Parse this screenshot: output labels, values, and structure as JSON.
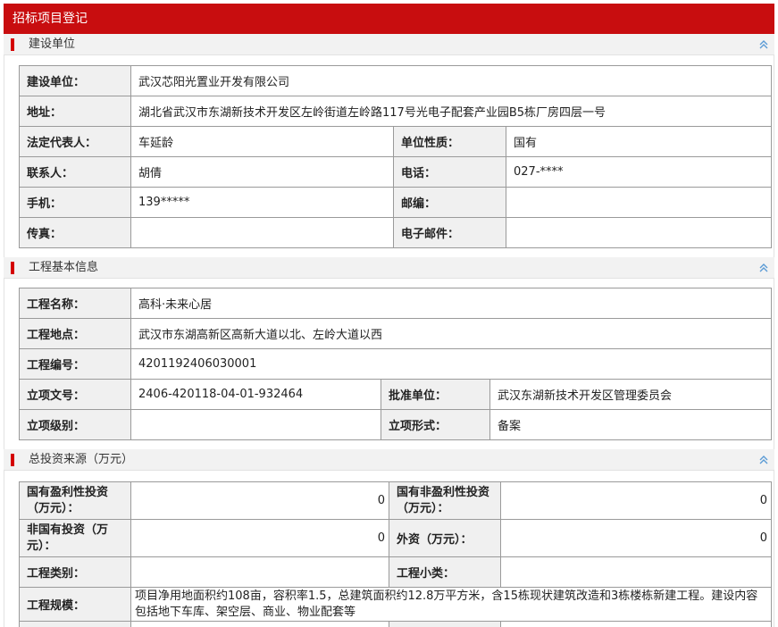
{
  "header": {
    "title": "招标项目登记"
  },
  "sections": {
    "builder": {
      "title": "建设单位",
      "rows": {
        "unit_label": "建设单位：",
        "unit": "武汉芯阳光置业开发有限公司",
        "address_label": "地址：",
        "address": "湖北省武汉市东湖新技术开发区左岭街道左岭路117号光电子配套产业园B5栋厂房四层一号",
        "legal_label": "法定代表人：",
        "legal": "车延龄",
        "nature_label": "单位性质：",
        "nature": "国有",
        "contact_label": "联系人：",
        "contact": "胡倩",
        "phone_label": "电话：",
        "phone": "027-****",
        "mobile_label": "手机：",
        "mobile": "139*****",
        "zip_label": "邮编：",
        "zip": "",
        "fax_label": "传真：",
        "fax": "",
        "email_label": "电子邮件：",
        "email": ""
      }
    },
    "project": {
      "title": "工程基本信息",
      "rows": {
        "name_label": "工程名称：",
        "name": "高科·未来心居",
        "location_label": "工程地点：",
        "location": "武汉市东湖高新区高新大道以北、左岭大道以西",
        "code_label": "工程编号：",
        "code": "4201192406030001",
        "approval_no_label": "立项文号：",
        "approval_no": "2406-420118-04-01-932464",
        "approver_label": "批准单位：",
        "approver": "武汉东湖新技术开发区管理委员会",
        "level_label": "立项级别：",
        "level": "",
        "form_label": "立项形式：",
        "form": "备案"
      }
    },
    "investment": {
      "title": "总投资来源（万元）",
      "rows": {
        "state_profit_label": "国有盈利性投资（万元）：",
        "state_profit": "0",
        "state_nonprofit_label": "国有非盈利性投资（万元）：",
        "state_nonprofit": "0",
        "nonstate_label": "非国有投资（万元）：",
        "nonstate": "0",
        "foreign_label": "外资（万元）：",
        "foreign": "0",
        "category_label": "工程类别：",
        "category": "",
        "subcategory_label": "工程小类：",
        "subcategory": "",
        "scale_label": "工程规模：",
        "scale": " 项目净用地面积约108亩，容积率1.5，总建筑面积约12.8万平方米，含15栋现状建筑改造和3栋楼栋新建工程。建设内容包括地下车库、架空层、商业、物业配套等"
      }
    }
  },
  "colors": {
    "accent": "#c80d0f",
    "label_bg": "#f0f0f0",
    "border": "#9a9a9a"
  },
  "icons": {
    "collapse": "double-chevron-up-icon"
  }
}
